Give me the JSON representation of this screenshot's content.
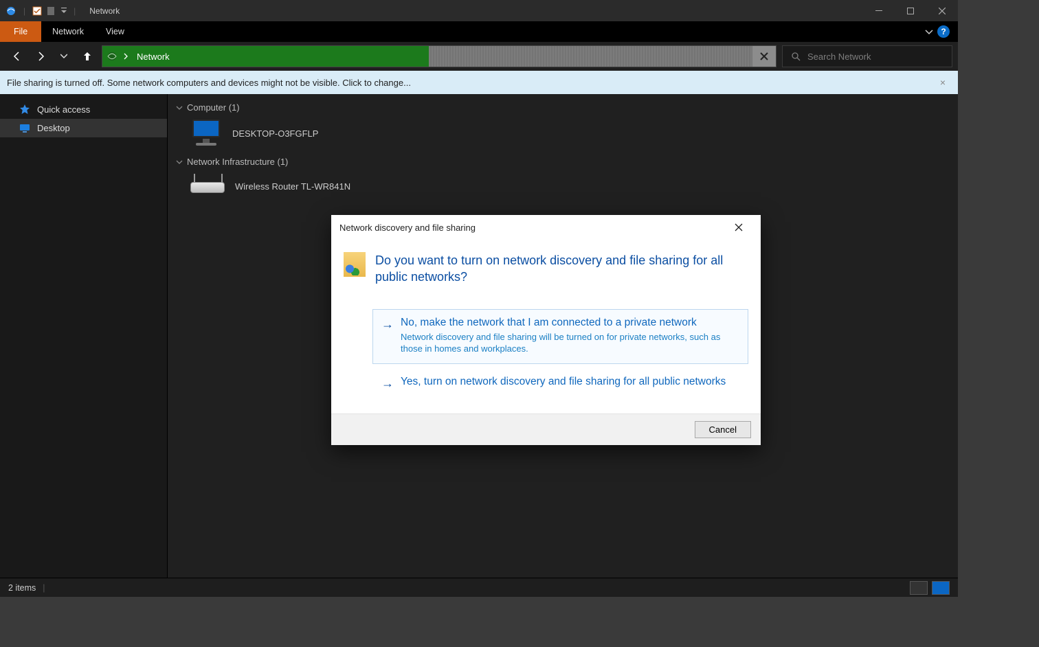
{
  "titlebar": {
    "title": "Network"
  },
  "ribbon": {
    "file": "File",
    "tabs": [
      "Network",
      "View"
    ]
  },
  "address": {
    "crumb": "Network"
  },
  "search": {
    "placeholder": "Search Network"
  },
  "banner": {
    "text": "File sharing is turned off. Some network computers and devices might not be visible. Click to change..."
  },
  "sidebar": {
    "items": [
      {
        "label": "Quick access"
      },
      {
        "label": "Desktop"
      }
    ]
  },
  "content": {
    "groups": [
      {
        "heading": "Computer (1)",
        "item": "DESKTOP-O3FGFLP"
      },
      {
        "heading": "Network Infrastructure (1)",
        "item": "Wireless Router TL-WR841N"
      }
    ]
  },
  "statusbar": {
    "count": "2 items"
  },
  "dialog": {
    "title": "Network discovery and file sharing",
    "headline": "Do you want to turn on network discovery and file sharing for all public networks?",
    "option1": {
      "title": "No, make the network that I am connected to a private network",
      "sub": "Network discovery and file sharing will be turned on for private networks, such as those in homes and workplaces."
    },
    "option2": {
      "title": "Yes, turn on network discovery and file sharing for all public networks"
    },
    "cancel": "Cancel"
  }
}
